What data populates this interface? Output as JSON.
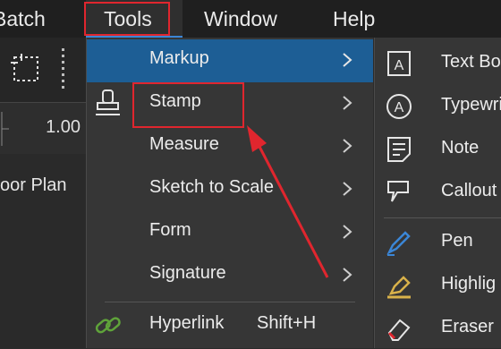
{
  "menubar": {
    "items": [
      {
        "label": "Batch"
      },
      {
        "label": "Tools"
      },
      {
        "label": "Window"
      },
      {
        "label": "Help"
      }
    ]
  },
  "workspace": {
    "zoom_value": "1.00",
    "left_panel_text": "oor Plan"
  },
  "tools_menu": {
    "items": [
      {
        "label": "Markup"
      },
      {
        "label": "Stamp"
      },
      {
        "label": "Measure"
      },
      {
        "label": "Sketch to Scale"
      },
      {
        "label": "Form"
      },
      {
        "label": "Signature"
      },
      {
        "label": "Hyperlink",
        "shortcut": "Shift+H"
      }
    ]
  },
  "markup_submenu": {
    "items": [
      {
        "label": "Text Bo"
      },
      {
        "label": "Typewri"
      },
      {
        "label": "Note"
      },
      {
        "label": "Callout"
      },
      {
        "label": "Pen"
      },
      {
        "label": "Highlig"
      },
      {
        "label": "Eraser"
      }
    ]
  },
  "colors": {
    "highlight": "#1d5e95",
    "annotation_red": "#e0262e",
    "pen_blue": "#3b86d6",
    "highlight_yellow": "#d9b24a",
    "hyperlink_green": "#5fa33a"
  }
}
